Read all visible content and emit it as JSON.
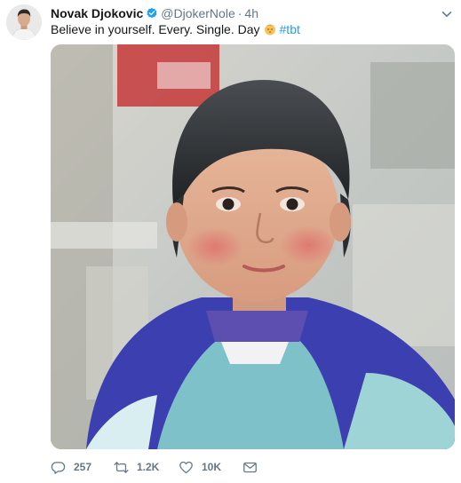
{
  "author": {
    "display_name": "Novak Djokovic",
    "handle": "@DjokerNole",
    "separator": "·",
    "time": "4h",
    "verified": true
  },
  "tweet": {
    "text": "Believe in yourself. Every. Single. Day",
    "emoji": "baby-face-emoji",
    "hashtag": "#tbt"
  },
  "actions": {
    "reply_count": "257",
    "retweet_count": "1.2K",
    "like_count": "10K"
  },
  "colors": {
    "link": "#1da1f2",
    "secondary_text": "#657786",
    "verified": "#1da1f2"
  }
}
